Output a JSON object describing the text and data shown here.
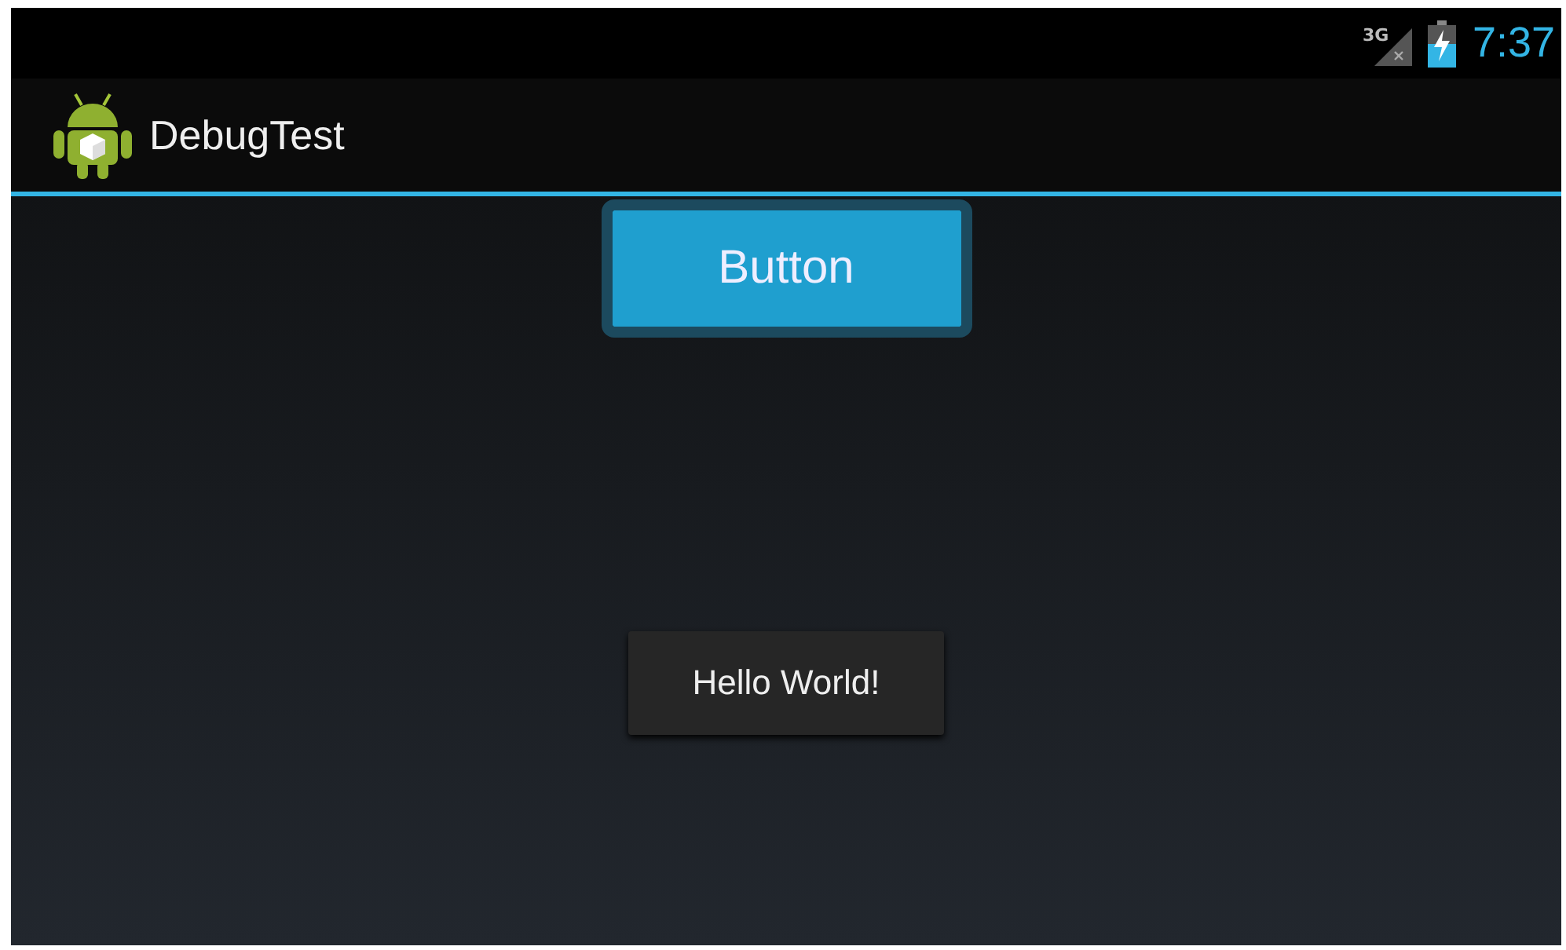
{
  "status_bar": {
    "network": "3G",
    "time": "7:37"
  },
  "action_bar": {
    "title": "DebugTest"
  },
  "button": {
    "label": "Button",
    "focused": true
  },
  "toast": {
    "text": "Hello World!"
  }
}
